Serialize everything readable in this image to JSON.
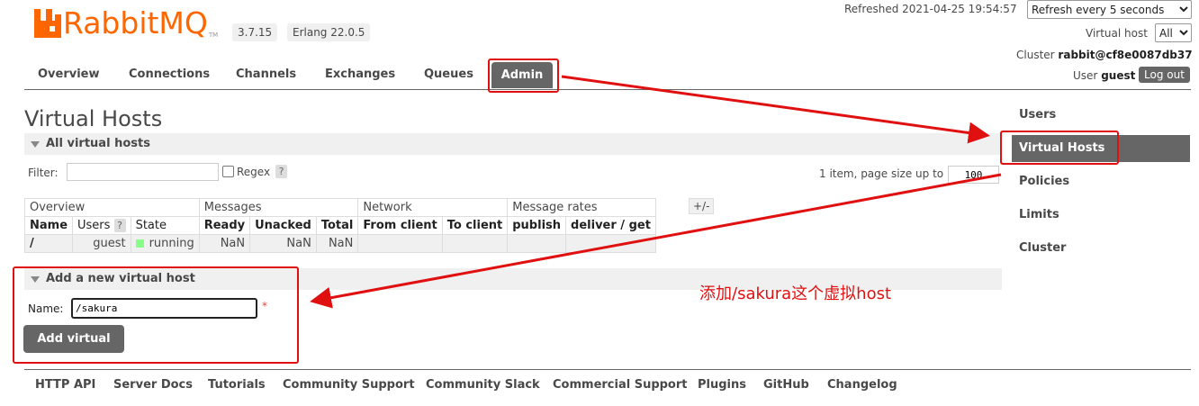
{
  "app": {
    "logo_text": "RabbitMQ",
    "logo_tm": "TM",
    "version": "3.7.15",
    "erlang": "Erlang 22.0.5"
  },
  "header": {
    "refreshed": "Refreshed 2021-04-25 19:54:57",
    "refresh_select": "Refresh every 5 seconds",
    "vhost_label": "Virtual host",
    "vhost_select": "All",
    "cluster_label": "Cluster",
    "cluster_name": "rabbit@cf8e0087db37",
    "user_label": "User",
    "user_name": "guest",
    "logout": "Log out"
  },
  "nav": {
    "tabs": [
      "Overview",
      "Connections",
      "Channels",
      "Exchanges",
      "Queues",
      "Admin"
    ]
  },
  "sidebar": {
    "items": [
      "Users",
      "Virtual Hosts",
      "Policies",
      "Limits",
      "Cluster"
    ]
  },
  "main": {
    "title": "Virtual Hosts",
    "section_all": "All virtual hosts",
    "filter_label": "Filter:",
    "regex_label": "Regex",
    "help": "?",
    "page_info": "1 item, page size up to",
    "page_size": "100",
    "plus_minus": "+/-",
    "table": {
      "groups": [
        "Overview",
        "Messages",
        "Network",
        "Message rates"
      ],
      "columns": [
        "Name",
        "Users",
        "State",
        "Ready",
        "Unacked",
        "Total",
        "From client",
        "To client",
        "publish",
        "deliver / get"
      ],
      "row": {
        "name": "/",
        "users": "guest",
        "state": "running",
        "ready": "NaN",
        "unacked": "NaN",
        "total": "NaN",
        "from_client": "",
        "to_client": "",
        "publish": "",
        "deliver_get": ""
      }
    },
    "section_add": "Add a new virtual host",
    "name_label": "Name:",
    "name_value": "/sakura",
    "required": "*",
    "add_button": "Add virtual host"
  },
  "annotation": {
    "text": "添加/sakura这个虚拟host",
    "color": "#e01010"
  },
  "footer": {
    "links": [
      "HTTP API",
      "Server Docs",
      "Tutorials",
      "Community Support",
      "Community Slack",
      "Commercial Support",
      "Plugins",
      "GitHub",
      "Changelog"
    ]
  },
  "colors": {
    "brand": "#ff6600",
    "nav_active": "#666666",
    "running": "#88ff88"
  }
}
